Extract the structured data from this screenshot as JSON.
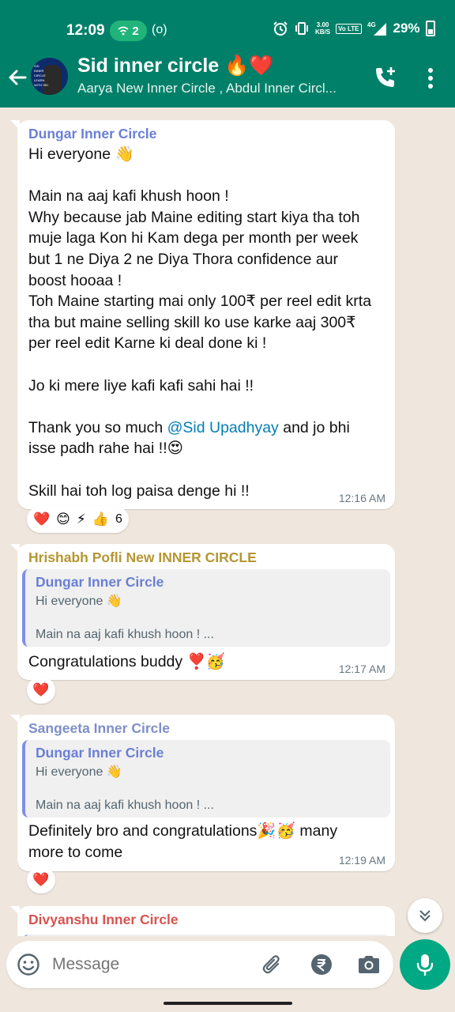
{
  "status_bar": {
    "time": "12:09",
    "hotspot_count": "2",
    "net_speed_value": "3.00",
    "net_speed_unit": "KB/S",
    "volte": "Vo LTE",
    "network": "4G",
    "battery": "29%"
  },
  "header": {
    "title": "Sid inner circle 🔥❤️",
    "subtitle": "Aarya New Inner Circle , Abdul Inner Circl...",
    "avatar_text": "SID INNER CIRCLE LEARN WITH SID",
    "colors": {
      "header_bg": "#008069"
    }
  },
  "messages": [
    {
      "sender": "Dungar Inner Circle",
      "sender_color": "#6a7fd6",
      "text_pre": "Hi everyone 👋\n\nMain na aaj kafi khush hoon !\nWhy because jab Maine editing start kiya tha toh\nmuje laga Kon hi Kam dega per month per week\nbut 1 ne Diya 2 ne Diya Thora confidence aur\nboost hooaa !\nToh Maine starting mai only 100₹ per reel edit krta\ntha but maine selling skill ko use karke aaj 300₹\nper reel edit Karne ki deal done ki !\n\nJo ki mere liye kafi kafi sahi hai !!\n\nThank you so much ",
      "mention": "@Sid Upadhyay",
      "text_post": " and jo bhi\nisse padh rahe hai !!😍\n\nSkill hai toh log paisa denge hi !!",
      "time": "12:16 AM",
      "reactions": [
        "❤️",
        "😊",
        "⚡",
        "👍"
      ],
      "reaction_count": "6"
    },
    {
      "sender": "Hrishabh Pofli New INNER CIRCLE",
      "sender_color": "#b59630",
      "quote": {
        "sender": "Dungar Inner Circle",
        "line1": "Hi everyone 👋",
        "line2": "Main na aaj kafi khush hoon ! ..."
      },
      "text": "Congratulations buddy ❣️🥳",
      "time": "12:17 AM",
      "reactions": [
        "❤️"
      ]
    },
    {
      "sender": "Sangeeta  Inner Circle",
      "sender_color": "#7e8fc9",
      "quote": {
        "sender": "Dungar Inner Circle",
        "line1": "Hi everyone 👋",
        "line2": "Main na aaj kafi khush hoon ! ..."
      },
      "text": "Definitely bro and congratulations🎉🥳 many\nmore to come",
      "time": "12:19 AM",
      "reactions": [
        "❤️"
      ]
    },
    {
      "sender": "Divyanshu Inner Circle",
      "sender_color": "#d9534f"
    }
  ],
  "input": {
    "placeholder": "Message"
  },
  "icons": {
    "back": "arrow-left-icon",
    "call": "add-call-icon",
    "menu": "more-vertical-icon",
    "emoji": "smiley-icon",
    "attach": "paperclip-icon",
    "payment": "rupee-icon",
    "camera": "camera-icon",
    "mic": "microphone-icon",
    "scroll": "double-chevron-down-icon"
  },
  "colors": {
    "accent": "#00a884",
    "chat_bg": "#efe7dd",
    "mention": "#027eb5"
  }
}
